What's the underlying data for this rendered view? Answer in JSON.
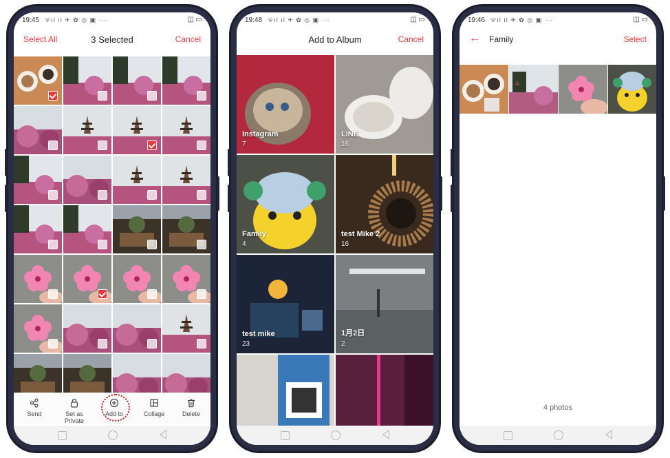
{
  "screens": [
    {
      "status": {
        "time": "19:45",
        "icons": "ᯤıl ıl ✈ ✿ ◎ ▣ ···",
        "right": "◫ ▭"
      },
      "header": {
        "left": "Select All",
        "center": "3 Selected",
        "right": "Cancel"
      },
      "toolbar": [
        {
          "icon": "share",
          "label": "Send"
        },
        {
          "icon": "lock",
          "label": "Set as Private"
        },
        {
          "icon": "add",
          "label": "Add to"
        },
        {
          "icon": "collage",
          "label": "Collage"
        },
        {
          "icon": "trash",
          "label": "Delete"
        }
      ],
      "grid_rows": 7,
      "grid_cols": 4,
      "selected_cells": [
        0,
        6,
        17
      ]
    },
    {
      "status": {
        "time": "19:48",
        "icons": "ᯤıl ıl ✈ ✿ ◎ ▣ ···",
        "right": "◫ ▭"
      },
      "header": {
        "center": "Add to Album",
        "right": "Cancel"
      },
      "albums": [
        {
          "name": "Instagram",
          "count": "7"
        },
        {
          "name": "LINE",
          "count": "16"
        },
        {
          "name": "Family",
          "count": "4"
        },
        {
          "name": "test Mike 2",
          "count": "16"
        },
        {
          "name": "test mike",
          "count": "23"
        },
        {
          "name": "1月2日",
          "count": "2"
        },
        {
          "name": "",
          "count": ""
        },
        {
          "name": "",
          "count": ""
        }
      ]
    },
    {
      "status": {
        "time": "19:46",
        "icons": "ᯤıl ıl ✈ ✿ ◎ ▣ ···",
        "right": "◫ ▭"
      },
      "header": {
        "title": "Family",
        "right": "Select"
      },
      "photo_count": "4 photos"
    }
  ],
  "colors": {
    "accent": "#e8383d",
    "blossom": "#c25c8a",
    "sky": "#dfe4e8",
    "tree": "#2f3b2a"
  }
}
